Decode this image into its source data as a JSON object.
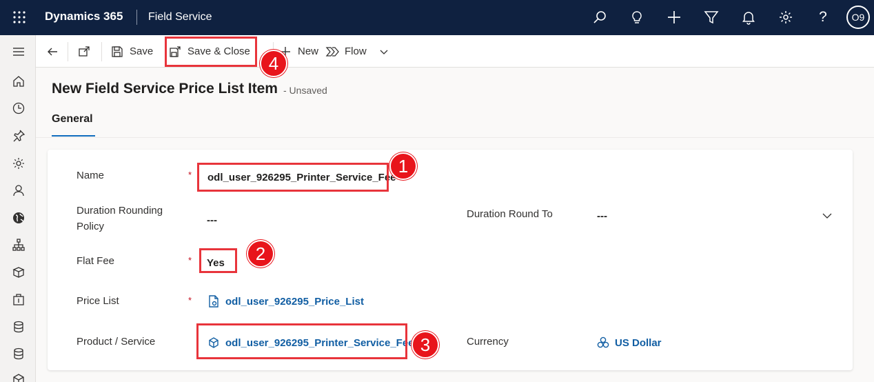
{
  "topbar": {
    "brand": "Dynamics 365",
    "app_name": "Field Service",
    "avatar_initials": "O9",
    "icons": [
      "search-icon",
      "lightbulb-icon",
      "plus-icon",
      "filter-icon",
      "bell-icon",
      "gear-icon",
      "help-icon"
    ]
  },
  "leftnav": {
    "icons": [
      "home-icon",
      "recent-icon",
      "pin-icon",
      "settings-icon",
      "person-icon",
      "globe-icon",
      "hierarchy-icon",
      "products-icon",
      "inventory-icon",
      "database-icon",
      "database-icon",
      "cube-icon"
    ]
  },
  "commandbar": {
    "save_label": "Save",
    "save_close_label": "Save & Close",
    "new_label": "New",
    "flow_label": "Flow"
  },
  "header": {
    "title": "New Field Service Price List Item",
    "status": "- Unsaved",
    "tab_general": "General"
  },
  "form": {
    "name_label": "Name",
    "name_value": "odl_user_926295_Printer_Service_Fee",
    "duration_rounding_label": "Duration Rounding Policy",
    "duration_rounding_value": "---",
    "duration_round_to_label": "Duration Round To",
    "duration_round_to_value": "---",
    "flat_fee_label": "Flat Fee",
    "flat_fee_value": "Yes",
    "price_list_label": "Price List",
    "price_list_value": "odl_user_926295_Price_List",
    "product_service_label": "Product / Service",
    "product_service_value": "odl_user_926295_Printer_Service_Fee",
    "currency_label": "Currency",
    "currency_value": "US Dollar",
    "required_mark": "*"
  },
  "annotations": {
    "step1": "1",
    "step2": "2",
    "step3": "3",
    "step4": "4",
    "color": "#e8343b"
  },
  "colors": {
    "topbar_bg": "#0f2140",
    "link": "#115ea3",
    "accent": "#0f6cbd",
    "required": "#c50f1f"
  }
}
